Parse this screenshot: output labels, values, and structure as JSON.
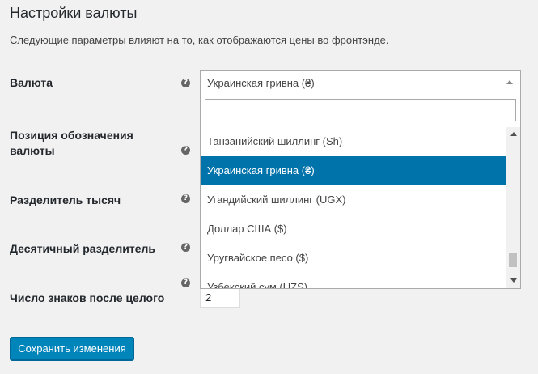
{
  "section": {
    "title": "Настройки валюты",
    "description": "Следующие параметры влияют на то, как отображаются цены во фронтэнде."
  },
  "fields": {
    "currency": {
      "label": "Валюта",
      "value": "Украинская гривна (₴)"
    },
    "currency_position": {
      "label_line1": "Позиция обозначения",
      "label_line2": "валюты"
    },
    "thousand_separator": {
      "label": "Разделитель тысяч"
    },
    "decimal_separator": {
      "label": "Десятичный разделитель"
    },
    "num_decimals": {
      "label": "Число знаков после целого",
      "value": "2"
    }
  },
  "help_icon_glyph": "?",
  "dropdown": {
    "search_value": "",
    "options": [
      {
        "label": "Танзанийский шиллинг (Sh)",
        "selected": false
      },
      {
        "label": "Украинская гривна (₴)",
        "selected": true
      },
      {
        "label": "Угандийский шиллинг (UGX)",
        "selected": false
      },
      {
        "label": "Доллар США ($)",
        "selected": false
      },
      {
        "label": "Уругвайское песо ($)",
        "selected": false
      },
      {
        "label": "Узбекский сум (UZS)",
        "selected": false
      }
    ]
  },
  "buttons": {
    "save_label": "Сохранить изменения"
  },
  "colors": {
    "primary": "#0085ba",
    "selected_option": "#0073aa",
    "background": "#f1f1f1"
  }
}
